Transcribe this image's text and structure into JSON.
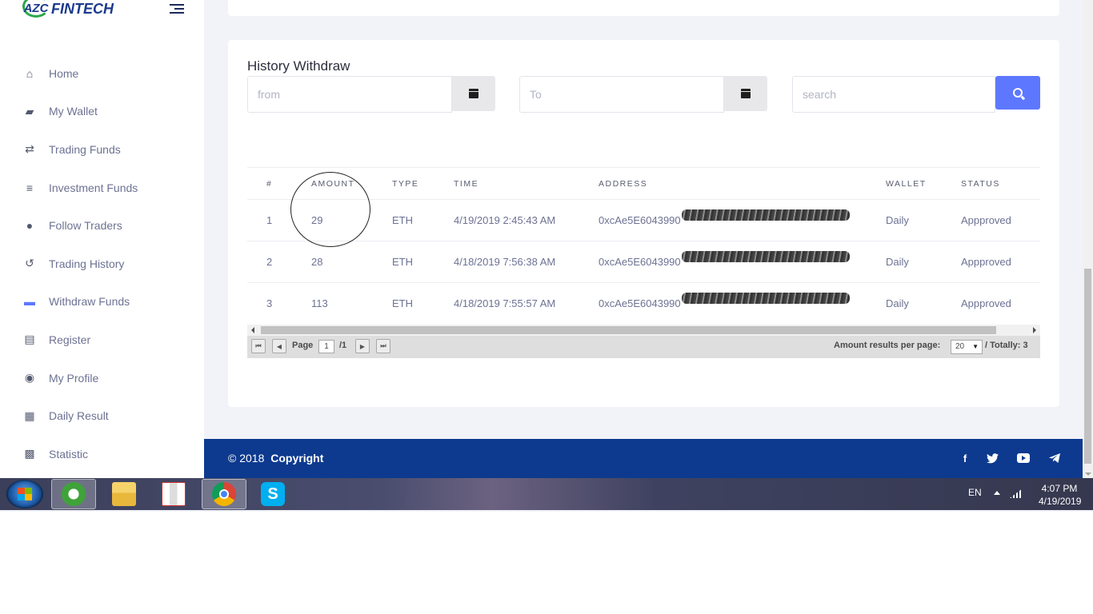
{
  "brand": {
    "mark": "AZC",
    "name": "FINTECH"
  },
  "nav": [
    {
      "label": "Home",
      "icon": "home-icon",
      "glyph": "⌂"
    },
    {
      "label": "My Wallet",
      "icon": "wallet-icon",
      "glyph": "▰"
    },
    {
      "label": "Trading Funds",
      "icon": "exchange-icon",
      "glyph": "⇄"
    },
    {
      "label": "Investment Funds",
      "icon": "database-icon",
      "glyph": "≡"
    },
    {
      "label": "Follow Traders",
      "icon": "copyright-icon",
      "glyph": "●"
    },
    {
      "label": "Trading History",
      "icon": "history-icon",
      "glyph": "↺"
    },
    {
      "label": "Withdraw Funds",
      "icon": "briefcase-icon",
      "glyph": "▬"
    },
    {
      "label": "Register",
      "icon": "register-icon",
      "glyph": "▤"
    },
    {
      "label": "My Profile",
      "icon": "user-circle-icon",
      "glyph": "◉"
    },
    {
      "label": "Daily Result",
      "icon": "file-icon",
      "glyph": "▦"
    },
    {
      "label": "Statistic",
      "icon": "statistic-icon",
      "glyph": "▩"
    }
  ],
  "active_nav": "Withdraw Funds",
  "history": {
    "title": "History Withdraw",
    "from_placeholder": "from",
    "to_placeholder": "To",
    "search_placeholder": "search"
  },
  "table": {
    "columns": [
      "#",
      "AMOUNT",
      "TYPE",
      "TIME",
      "ADDRESS",
      "WALLET",
      "STATUS"
    ],
    "rows": [
      {
        "no": "1",
        "amount": "29",
        "type": "ETH",
        "time": "4/19/2019 2:45:43 AM",
        "address": "0xcAe5E6043990",
        "wallet": "Daily",
        "status": "Appproved"
      },
      {
        "no": "2",
        "amount": "28",
        "type": "ETH",
        "time": "4/18/2019 7:56:38 AM",
        "address": "0xcAe5E6043990",
        "wallet": "Daily",
        "status": "Appproved"
      },
      {
        "no": "3",
        "amount": "113",
        "type": "ETH",
        "time": "4/18/2019 7:55:57 AM",
        "address": "0xcAe5E6043990",
        "wallet": "Daily",
        "status": "Appproved"
      }
    ]
  },
  "pager": {
    "page_label": "Page",
    "page_value": "1",
    "page_total": "/1",
    "per_page_label": "Amount results per page:",
    "per_page_value": "20",
    "total": "/ Totally: 3"
  },
  "footer": {
    "copyright": "© 2018",
    "copyright_bold": "Copyright"
  },
  "taskbar": {
    "lang": "EN",
    "time": "4:07 PM",
    "date": "4/19/2019"
  },
  "colors": {
    "accent": "#5d78ff",
    "footer": "#0d3a8e",
    "brand": "#1b3a8c"
  }
}
